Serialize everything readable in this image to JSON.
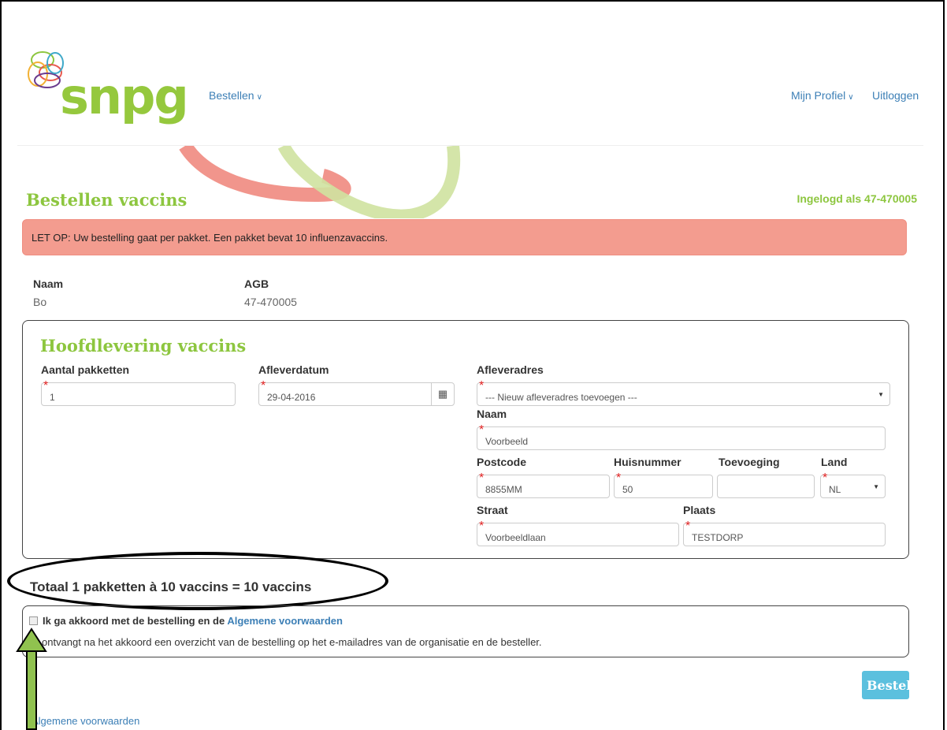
{
  "header": {
    "logo_text": "snpg",
    "nav": {
      "order": "Bestellen",
      "profile": "Mijn Profiel",
      "logout": "Uitloggen"
    }
  },
  "page": {
    "title": "Bestellen vaccins",
    "logged_in": "Ingelogd als 47-470005",
    "alert": "LET OP: Uw bestelling gaat per pakket. Een pakket bevat 10 influenzavaccins."
  },
  "customer": {
    "name_label": "Naam",
    "name_value": "Bo",
    "agb_label": "AGB",
    "agb_value": "47-470005"
  },
  "delivery": {
    "title": "Hoofdlevering vaccins",
    "packages_label": "Aantal pakketten",
    "packages_value": "1",
    "date_label": "Afleverdatum",
    "date_value": "29-04-2016",
    "address_label": "Afleveradres",
    "address_value": "--- Nieuw afleveradres toevoegen ---",
    "name_label": "Naam",
    "name_value": "Voorbeeld",
    "postcode_label": "Postcode",
    "postcode_value": "8855MM",
    "housenumber_label": "Huisnummer",
    "housenumber_value": "50",
    "addition_label": "Toevoeging",
    "addition_value": "",
    "country_label": "Land",
    "country_value": "NL",
    "street_label": "Straat",
    "street_value": "Voorbeeldlaan",
    "city_label": "Plaats",
    "city_value": "TESTDORP"
  },
  "summary": {
    "total": "Totaal 1 pakketten à 10 vaccins = 10 vaccins"
  },
  "agreement": {
    "text": "Ik ga akkoord met de bestelling en de ",
    "link": "Algemene voorwaarden",
    "note": "U ontvangt na het akkoord een overzicht van de bestelling op het e-mailadres van de organisatie en de besteller."
  },
  "actions": {
    "order_button": "Bestel"
  },
  "footer": {
    "terms_link": "Algemene voorwaarden"
  },
  "colors": {
    "brand_green": "#8dc63f",
    "link_blue": "#3c7fb6",
    "alert_red": "#f39c8f",
    "button_blue": "#5bc0de"
  }
}
